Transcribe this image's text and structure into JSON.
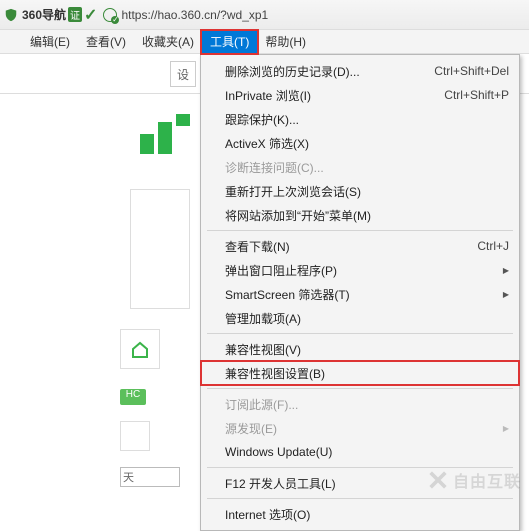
{
  "title_bar": {
    "site_title": "360导航",
    "badge_text": "证",
    "url": "https://hao.360.cn/?wd_xp1"
  },
  "menu_bar": {
    "edit": "编辑(E)",
    "view": "查看(V)",
    "favorites": "收藏夹(A)",
    "tools": "工具(T)",
    "help": "帮助(H)"
  },
  "dropdown": {
    "items": [
      {
        "label": "删除浏览的历史记录(D)...",
        "shortcut": "Ctrl+Shift+Del"
      },
      {
        "label": "InPrivate 浏览(I)",
        "shortcut": "Ctrl+Shift+P"
      },
      {
        "label": "跟踪保护(K)...",
        "shortcut": ""
      },
      {
        "label": "ActiveX 筛选(X)",
        "shortcut": ""
      },
      {
        "label": "诊断连接问题(C)...",
        "shortcut": "",
        "disabled": true
      },
      {
        "label": "重新打开上次浏览会话(S)",
        "shortcut": ""
      },
      {
        "label": "将网站添加到“开始”菜单(M)",
        "shortcut": ""
      }
    ],
    "group2": [
      {
        "label": "查看下载(N)",
        "shortcut": "Ctrl+J"
      },
      {
        "label": "弹出窗口阻止程序(P)",
        "shortcut": "",
        "arrow": true
      },
      {
        "label": "SmartScreen 筛选器(T)",
        "shortcut": "",
        "arrow": true
      },
      {
        "label": "管理加载项(A)",
        "shortcut": ""
      }
    ],
    "group3": [
      {
        "label": "兼容性视图(V)",
        "shortcut": ""
      },
      {
        "label": "兼容性视图设置(B)",
        "shortcut": "",
        "boxed": true
      }
    ],
    "group4": [
      {
        "label": "订阅此源(F)...",
        "shortcut": "",
        "disabled": true
      },
      {
        "label": "源发现(E)",
        "shortcut": "",
        "disabled": true,
        "arrow": true
      },
      {
        "label": "Windows Update(U)",
        "shortcut": ""
      }
    ],
    "group5": [
      {
        "label": "F12 开发人员工具(L)",
        "shortcut": ""
      }
    ],
    "group6": [
      {
        "label": "Internet 选项(O)",
        "shortcut": ""
      }
    ]
  },
  "page_bg": {
    "settings_char": "设",
    "hot_tag": "HC",
    "input_text": "天"
  },
  "watermark": "自由互联"
}
